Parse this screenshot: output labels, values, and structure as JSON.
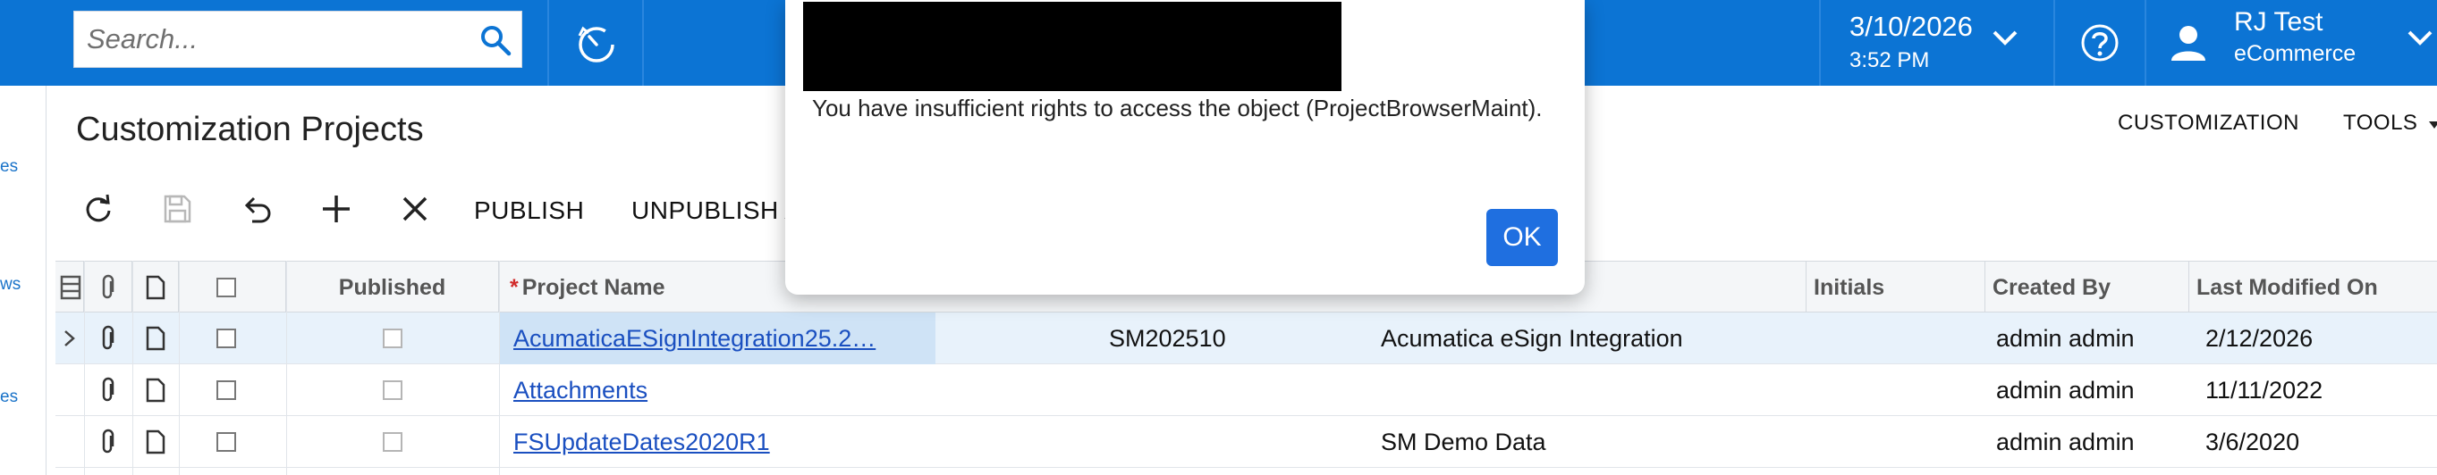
{
  "topbar": {
    "search_placeholder": "Search...",
    "date": "3/10/2026",
    "time": "3:52 PM",
    "user_name": "RJ Test",
    "user_company": "eCommerce",
    "icons": [
      "search-icon",
      "history-icon",
      "chevron-down-icon",
      "help-icon",
      "user-icon"
    ]
  },
  "left_nav": {
    "links": [
      "es",
      "ws",
      "es"
    ]
  },
  "page": {
    "title": "Customization Projects",
    "header_links": [
      "CUSTOMIZATION",
      "TOOLS"
    ]
  },
  "toolbar": {
    "publish_label": "PUBLISH",
    "unpublish_label": "UNPUBLISH A",
    "icons": [
      "refresh-icon",
      "save-icon",
      "undo-icon",
      "add-icon",
      "delete-icon"
    ]
  },
  "grid": {
    "columns": [
      "Published",
      "Project Name",
      "Initials",
      "Created By",
      "Last Modified On"
    ],
    "required_marker": "*",
    "rows": [
      {
        "project_name": "AcumaticaESignIntegration25.2…",
        "screen": "SM202510",
        "description": "Acumatica eSign Integration",
        "created_by": "admin admin",
        "last_modified": "2/12/2026"
      },
      {
        "project_name": "Attachments",
        "screen": "",
        "description": "",
        "created_by": "admin admin",
        "last_modified": "11/11/2022"
      },
      {
        "project_name": "FSUpdateDates2020R1",
        "screen": "",
        "description": "SM Demo Data",
        "created_by": "admin admin",
        "last_modified": "3/6/2020"
      }
    ]
  },
  "modal": {
    "message": "You have insufficient rights to access the object (ProjectBrowserMaint).",
    "ok_label": "OK"
  },
  "colors": {
    "topbar": "#0c74d4",
    "ok_button": "#1f6fe0",
    "link": "#1a4fc0",
    "selected_row": "#e8f2fb"
  }
}
